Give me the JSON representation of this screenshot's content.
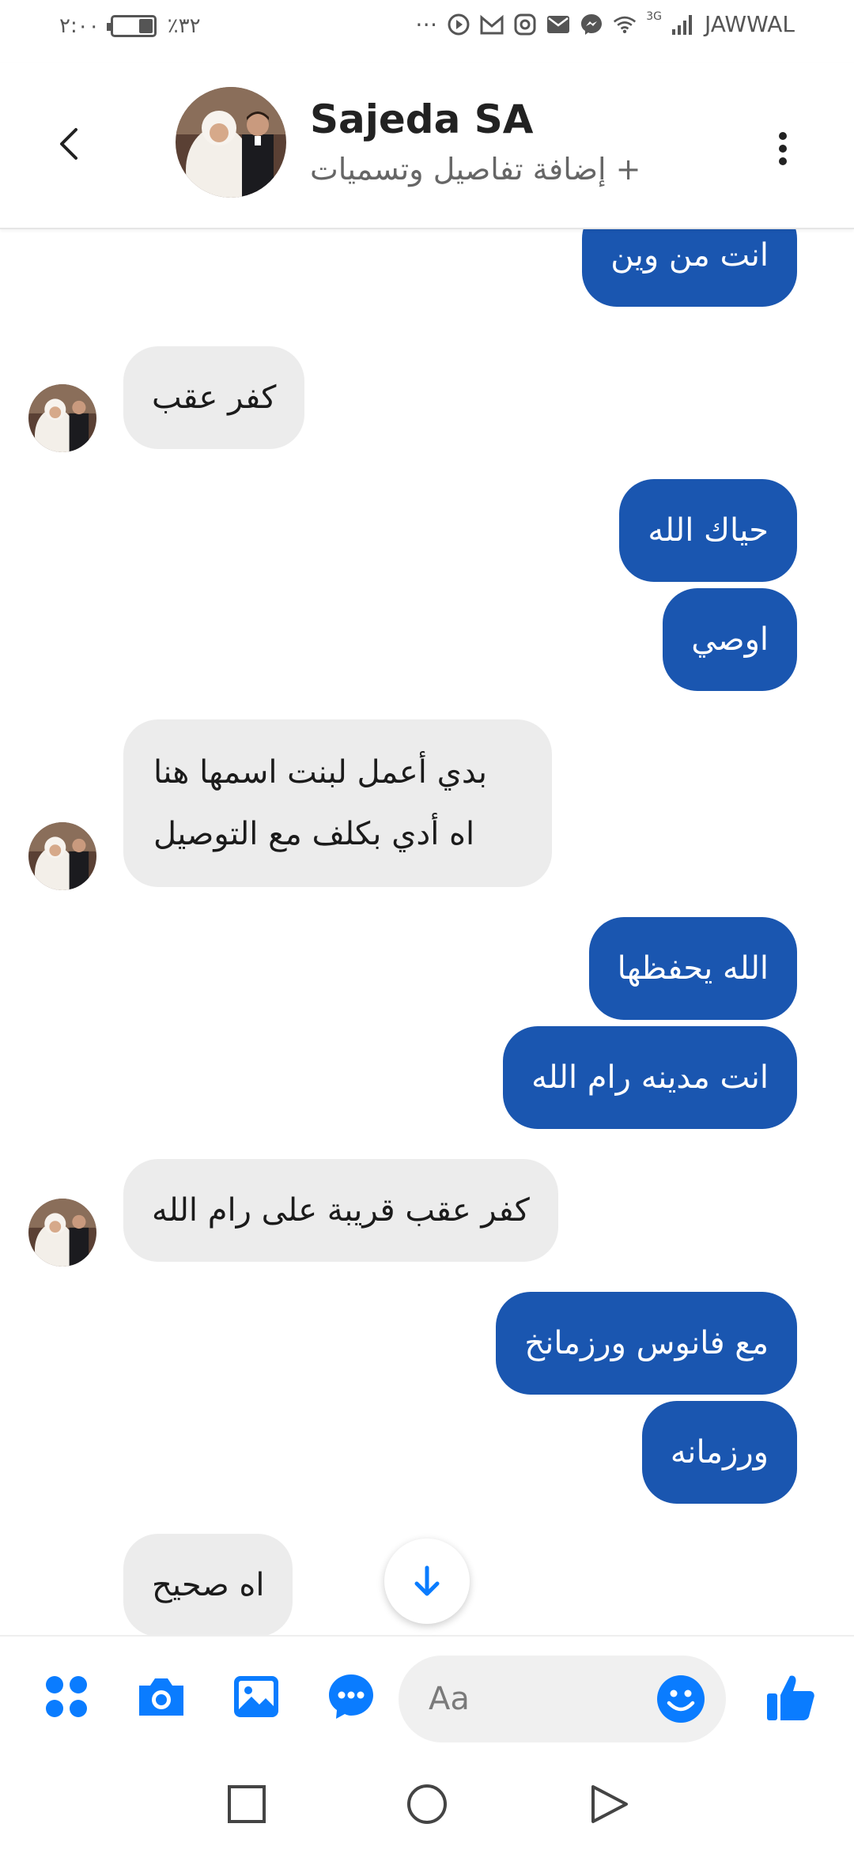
{
  "status_bar": {
    "time": "٢:٠٠",
    "battery": "٪٣٢",
    "carrier": "JAWWAL",
    "network": "3G"
  },
  "header": {
    "contact_name": "Sajeda SA",
    "subtitle": "+ إضافة تفاصيل وتسميات"
  },
  "messages": [
    {
      "dir": "out",
      "text": "انت من وين"
    },
    {
      "dir": "in",
      "text": "كفر عقب"
    },
    {
      "dir": "out",
      "text": "حياك الله"
    },
    {
      "dir": "out",
      "text": "اوصي"
    },
    {
      "dir": "in",
      "line1": "بدي أعمل لبنت اسمها هنا",
      "line2": "اه أدي بكلف مع التوصيل"
    },
    {
      "dir": "out",
      "text": "الله يحفظها"
    },
    {
      "dir": "out",
      "text": "انت مدينه رام الله"
    },
    {
      "dir": "in",
      "text": "كفر عقب قريبة على رام الله"
    },
    {
      "dir": "out",
      "text": "مع فانوس ورزمانخ"
    },
    {
      "dir": "out",
      "text": "ورزمانه"
    },
    {
      "dir": "in",
      "text": "اه صحيح"
    }
  ],
  "composer": {
    "placeholder": "Aa"
  },
  "colors": {
    "accent": "#0a7cff",
    "outgoing_bubble": "#1a56b0",
    "incoming_bubble": "#ececec"
  }
}
